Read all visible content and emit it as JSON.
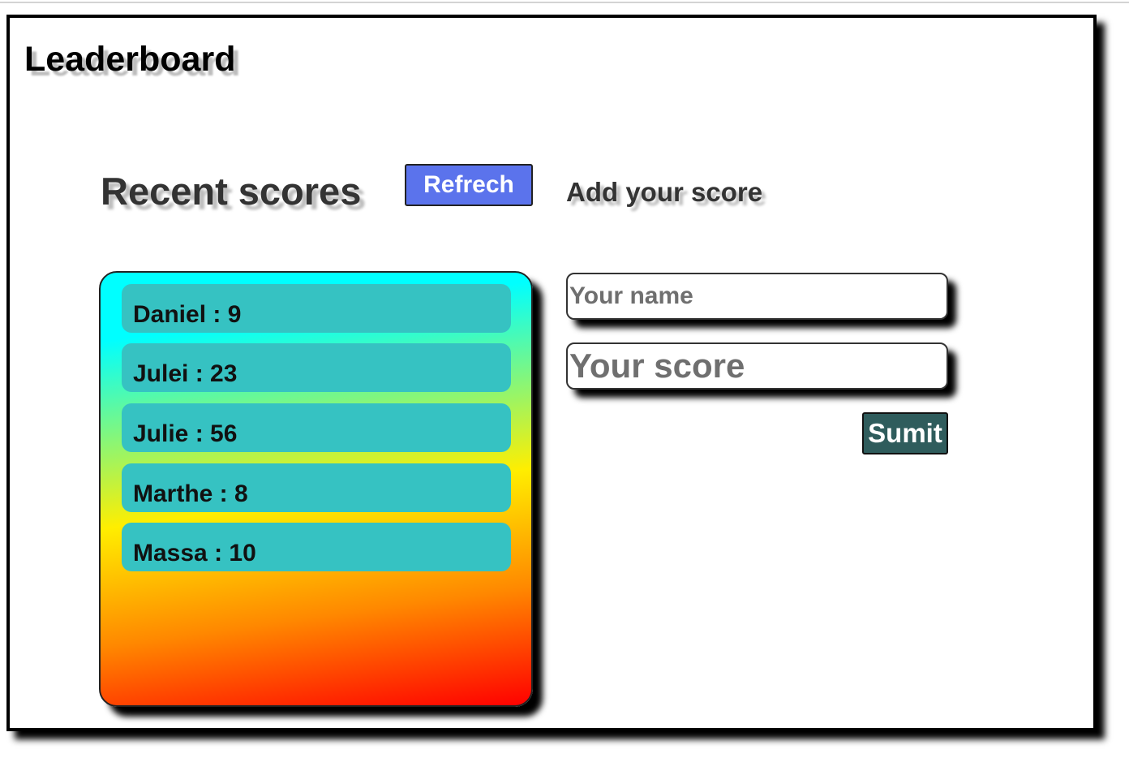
{
  "header": {
    "title": "Leaderboard"
  },
  "scores_section": {
    "title": "Recent scores",
    "refresh_label": "Refrech",
    "scores": [
      {
        "text": "Daniel : 9"
      },
      {
        "text": "Julei : 23"
      },
      {
        "text": "Julie : 56"
      },
      {
        "text": "Marthe : 8"
      },
      {
        "text": "Massa : 10"
      }
    ]
  },
  "add_section": {
    "title": "Add your score",
    "name_placeholder": "Your name",
    "score_placeholder": "Your score",
    "submit_label": "Sumit"
  },
  "colors": {
    "refresh_button": "#5b73ec",
    "submit_button": "#2f5c5c",
    "score_row": "#36c2c2"
  }
}
